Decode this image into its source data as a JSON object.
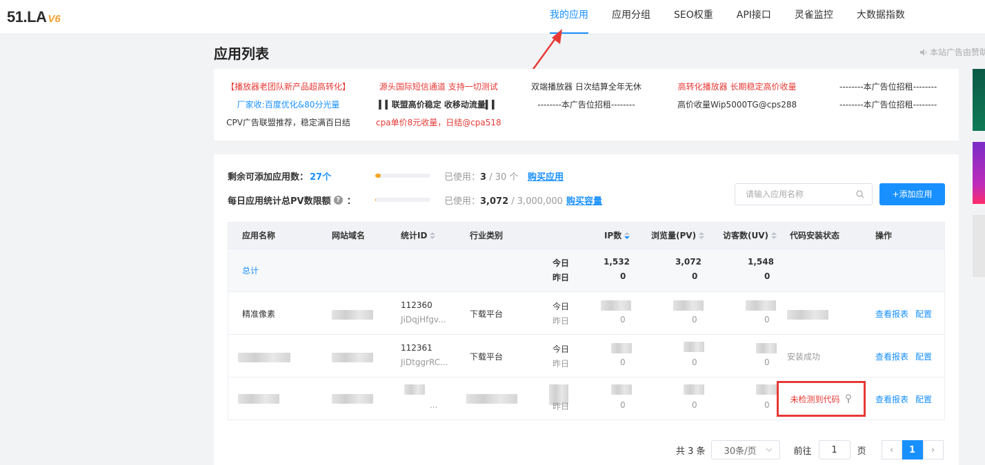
{
  "logo": {
    "main": "51.LA",
    "version": "V6"
  },
  "nav": [
    {
      "label": "我的应用",
      "active": true
    },
    {
      "label": "应用分组"
    },
    {
      "label": "SEO权重"
    },
    {
      "label": "API接口"
    },
    {
      "label": "灵雀监控"
    },
    {
      "label": "大数据指数"
    }
  ],
  "page_title": "应用列表",
  "ad_note": "本站广告由赞助",
  "ads": [
    [
      "【播放器老团队新产品超高转化】",
      "厂家收:百度优化&80分光量",
      "CPV广告联盟推荐，稳定满百日结"
    ],
    [
      "源头国际短信通道 支持一切测试",
      "▍▍联盟高价稳定 收移动流量▍▍",
      "cpa单价8元收量，日结@cpa518"
    ],
    [
      "双端播放器 日次结算全年无休",
      "--------本广告位招租--------"
    ],
    [
      "高转化播放器 长期稳定高价收量",
      "高价收量Wip5000TG@cps288"
    ],
    [
      "--------本广告位招租--------",
      "--------本广告位招租--------"
    ]
  ],
  "quota": {
    "apps_label": "剩余可添加应用数：",
    "apps_remaining": "27个",
    "apps_used_prefix": "已使用：",
    "apps_used": "3",
    "apps_total": " / 30 个",
    "apps_used_fraction": 0.1,
    "buy_app": "购买应用",
    "pv_label": "每日应用统计总PV数限额",
    "pv_colon": "：",
    "help": "?",
    "pv_used_prefix": "已使用：",
    "pv_used": "3,072",
    "pv_total": " / 3,000,000",
    "pv_used_fraction": 0.001,
    "buy_capacity": "购买容量"
  },
  "search": {
    "placeholder": "请输入应用名称"
  },
  "add_button": "+添加应用",
  "table": {
    "headers": {
      "name": "应用名称",
      "domain": "网站域名",
      "stat_id": "统计ID",
      "industry": "行业类别",
      "ip": "IP数",
      "pv": "浏览量(PV)",
      "uv": "访客数(UV)",
      "status": "代码安装状态",
      "ops": "操作"
    },
    "total": {
      "label": "总计",
      "today_label": "今日",
      "yesterday_label": "昨日",
      "ip_today": "1,532",
      "ip_yesterday": "0",
      "pv_today": "3,072",
      "pv_yesterday": "0",
      "uv_today": "1,548",
      "uv_yesterday": "0"
    },
    "rows": [
      {
        "name": "精准像素",
        "stat_id": "112360",
        "stat_key": "JiDqjHfgv...",
        "industry": "下载平台",
        "today_label": "今日",
        "yesterday_label": "昨日",
        "yesterday_value": "0",
        "status": "",
        "report": "查看报表",
        "config": "配置"
      },
      {
        "name": "",
        "stat_id": "112361",
        "stat_key": "JiDtggrRC...",
        "industry": "下载平台",
        "today_label": "今日",
        "yesterday_label": "昨日",
        "ip_yesterday": "0",
        "pv_yesterday": "0",
        "uv_yesterday": "0",
        "status": "安装成功",
        "report": "查看报表",
        "config": "配置"
      },
      {
        "name": "",
        "stat_id": "",
        "stat_key": "...",
        "industry": "",
        "yesterday_label": "昨日",
        "yesterday_value": "0",
        "status": "未检测到代码",
        "report": "查看报表",
        "config": "配置"
      }
    ]
  },
  "pagination": {
    "total": "共 3 条",
    "page_size": "30条/页",
    "goto_label": "前往",
    "goto_value": "1",
    "page_unit": "页",
    "prev": "‹",
    "next": "›",
    "current": "1"
  },
  "colors": {
    "accent": "#1890ff",
    "danger": "#e53935",
    "warning": "#f5a623"
  }
}
